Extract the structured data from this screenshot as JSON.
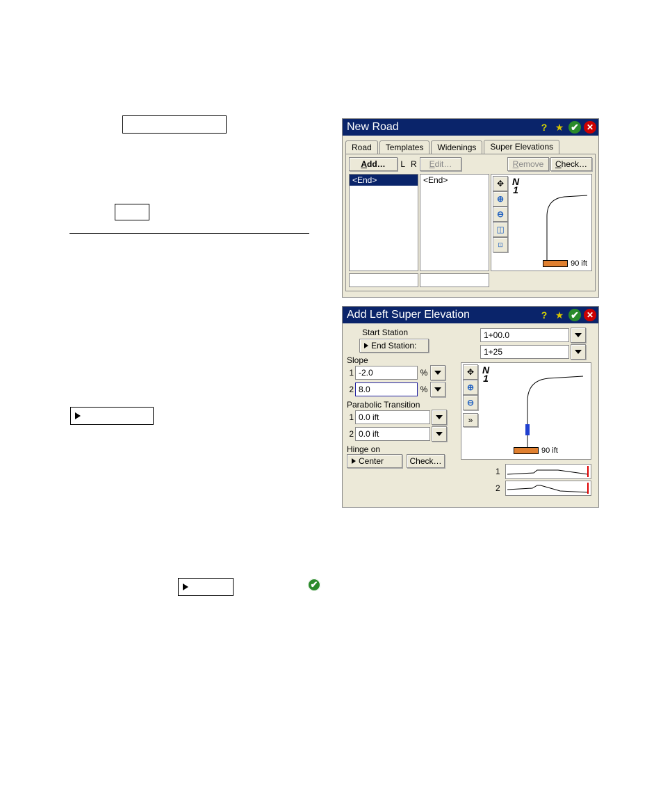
{
  "freestanding": {
    "box1_placeholder": "",
    "box2_placeholder": "",
    "box3_placeholder": "",
    "box4_placeholder": ""
  },
  "window1": {
    "title": "New Road",
    "tabs": [
      "Road",
      "Templates",
      "Widenings",
      "Super Elevations"
    ],
    "selected_tab": 3,
    "toolbar": {
      "add": "Add…",
      "lr": {
        "l": "L",
        "r": "R"
      },
      "edit": "Edit…",
      "remove": "Remove",
      "check": "Check…"
    },
    "left_list": {
      "items": [
        "<End>"
      ],
      "selected": 0
    },
    "right_list": {
      "items": [
        "<End>"
      ]
    },
    "preview": {
      "zoom_buttons": [
        "fit-icon",
        "zoom-in-icon",
        "zoom-out-icon",
        "zoom-window-icon",
        "zoom-100-icon"
      ],
      "north": "N",
      "north_sub": "1",
      "scale": "90 ift"
    }
  },
  "window2": {
    "title": "Add Left Super Elevation",
    "start_station": {
      "label": "Start Station",
      "value": "1+00.0"
    },
    "end_station": {
      "label": "End Station:",
      "value": "1+25"
    },
    "slope_label": "Slope",
    "slope1": {
      "num": "1",
      "value": "-2.0",
      "unit": "%"
    },
    "slope2": {
      "num": "2",
      "value": "8.0",
      "unit": "%"
    },
    "parabolic_label": "Parabolic Transition",
    "para1": {
      "num": "1",
      "value": "0.0 ift"
    },
    "para2": {
      "num": "2",
      "value": "0.0 ift"
    },
    "hinge_label": "Hinge on",
    "hinge_value": "Center",
    "check": "Check…",
    "preview": {
      "zoom_buttons": [
        "fit-icon",
        "zoom-in-icon",
        "zoom-out-icon"
      ],
      "north": "N",
      "north_sub": "1",
      "scale": "90 ift"
    },
    "xsection_nums": [
      "1",
      "2"
    ],
    "expand_label": "»"
  }
}
